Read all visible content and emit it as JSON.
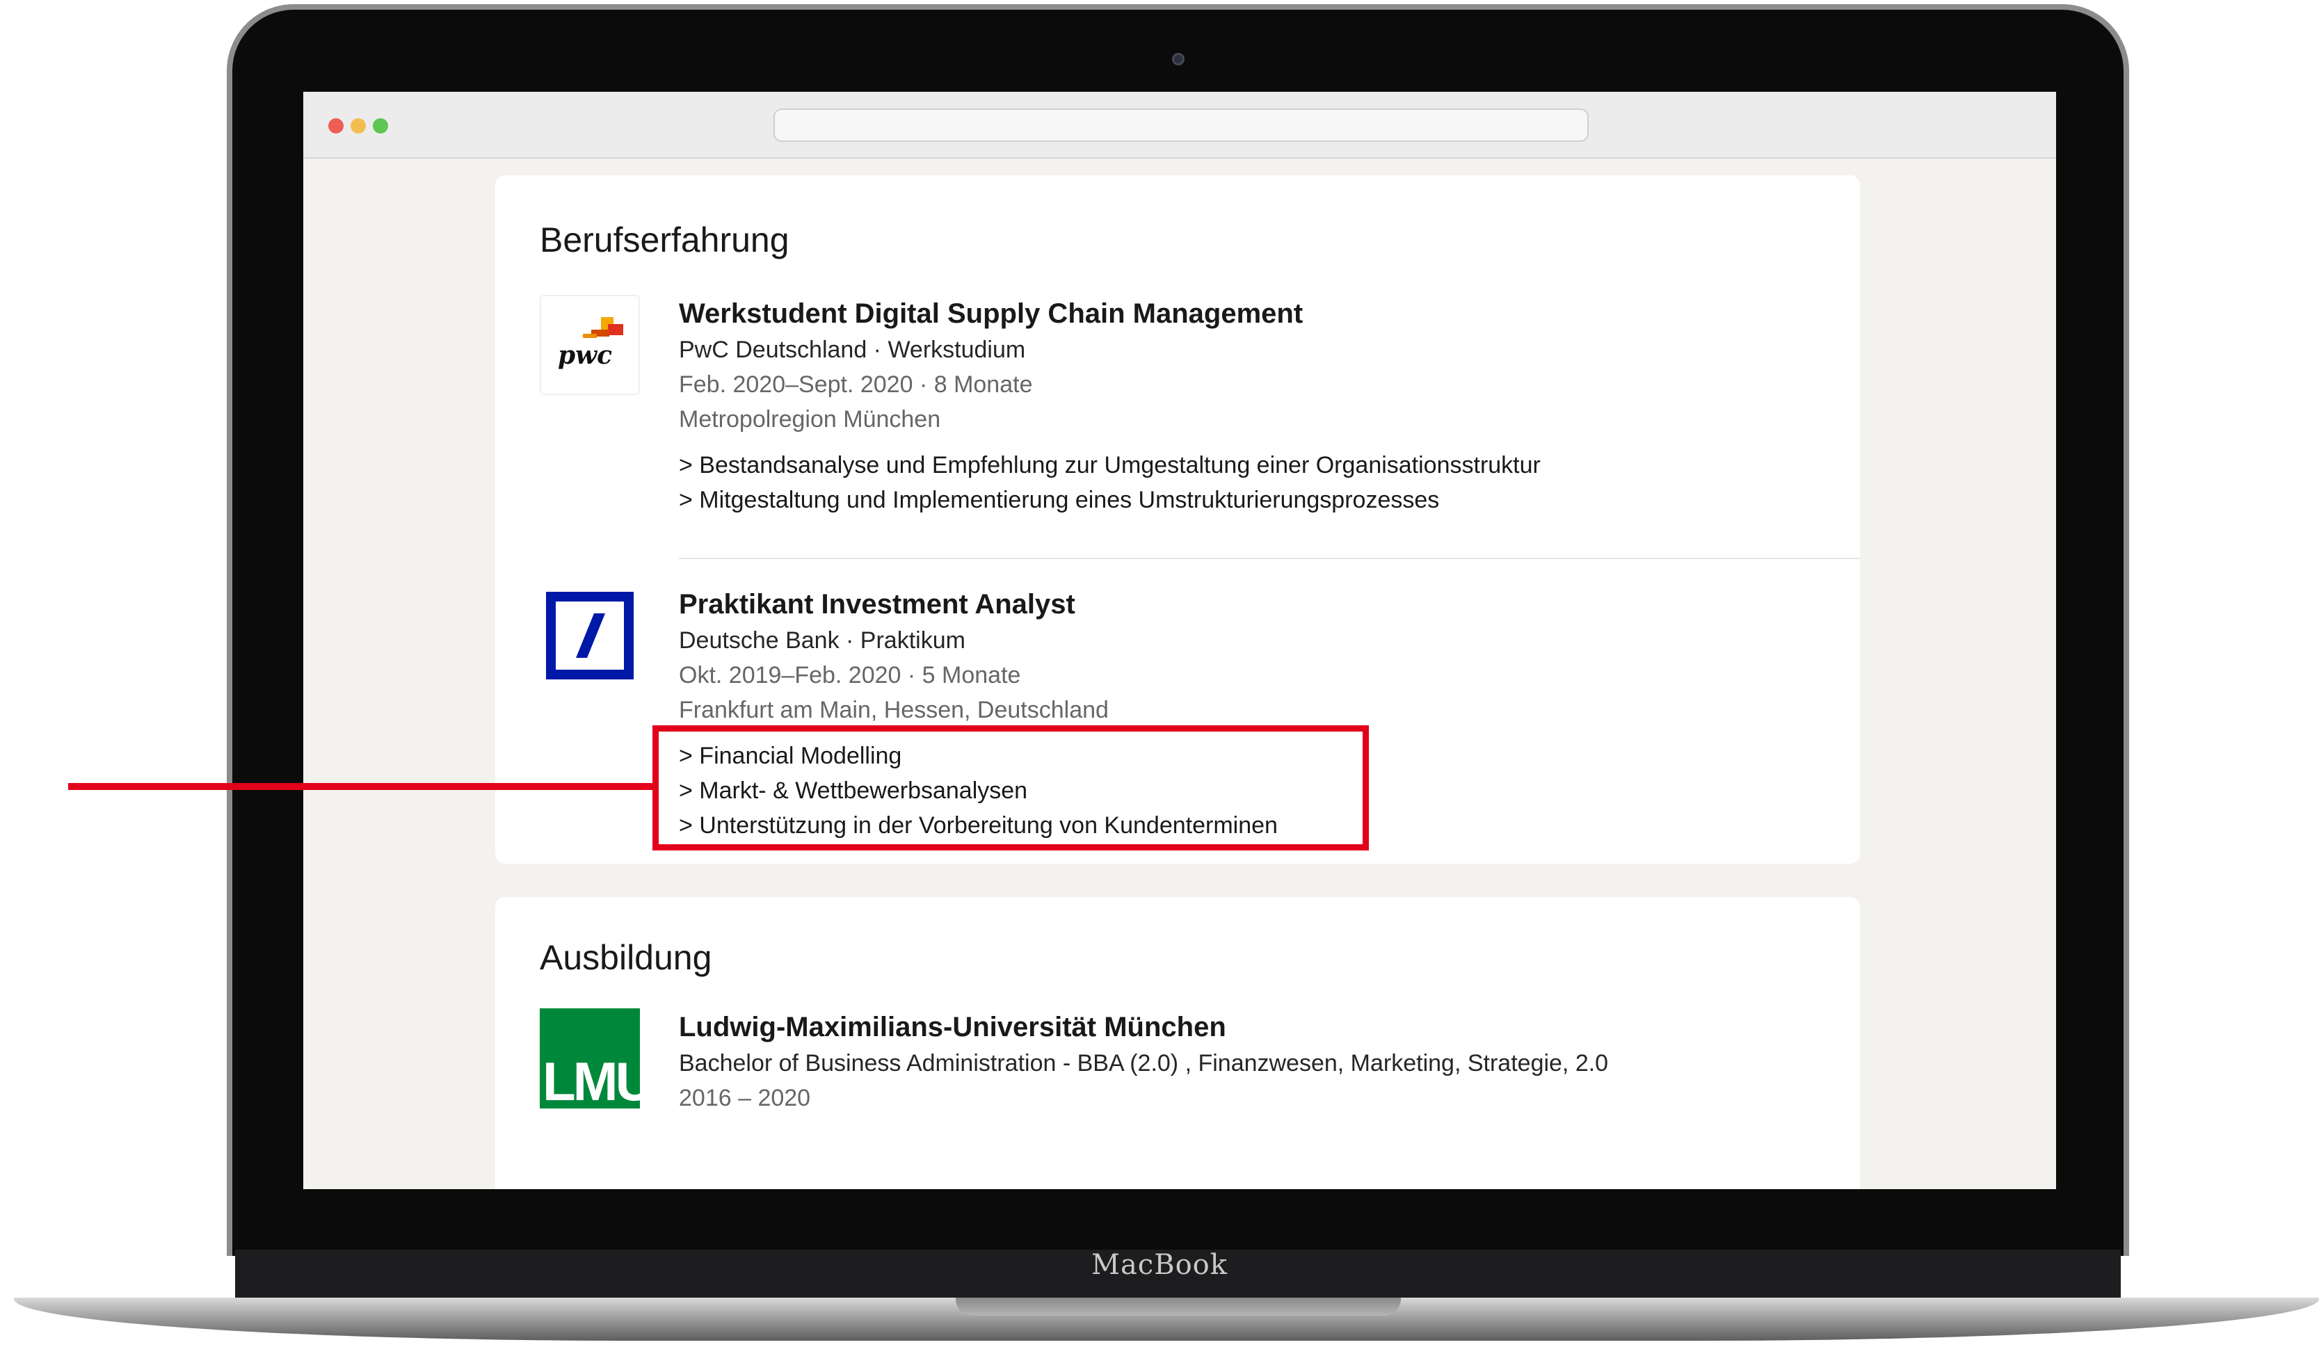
{
  "device": {
    "brand_label": "MacBook"
  },
  "experience": {
    "title": "Berufserfahrung",
    "entries": [
      {
        "logo": "pwc-logo",
        "logo_text": "pwc",
        "role": "Werkstudent Digital Supply Chain Management",
        "company": "PwC Deutschland · Werkstudium",
        "dates": "Feb. 2020–Sept. 2020 · 8 Monate",
        "location": "Metropolregion München",
        "bullets": [
          "> Bestandsanalyse und Empfehlung zur Umgestaltung einer Organisationsstruktur",
          "> Mitgestaltung und Implementierung eines Umstrukturierungsprozesses"
        ]
      },
      {
        "logo": "deutsche-bank-logo",
        "role": "Praktikant Investment Analyst",
        "company": "Deutsche Bank · Praktikum",
        "dates": "Okt. 2019–Feb. 2020 · 5 Monate",
        "location": "Frankfurt am Main, Hessen, Deutschland",
        "bullets": [
          "> Financial Modelling",
          "> Markt- & Wettbewerbsanalysen",
          "> Unterstützung in der Vorbereitung von Kundenterminen"
        ]
      }
    ]
  },
  "education": {
    "title": "Ausbildung",
    "entries": [
      {
        "logo": "lmu-logo",
        "logo_text": "LMU",
        "school": "Ludwig-Maximilians-Universität München",
        "degree": "Bachelor of Business Administration - BBA (2.0) , Finanzwesen, Marketing, Strategie, 2.0",
        "dates": "2016 – 2020"
      }
    ]
  },
  "colors": {
    "highlight": "#e3001b",
    "deutsche_bank_blue": "#0018a8",
    "lmu_green": "#00883a",
    "pwc_orange": "#e0301e"
  }
}
